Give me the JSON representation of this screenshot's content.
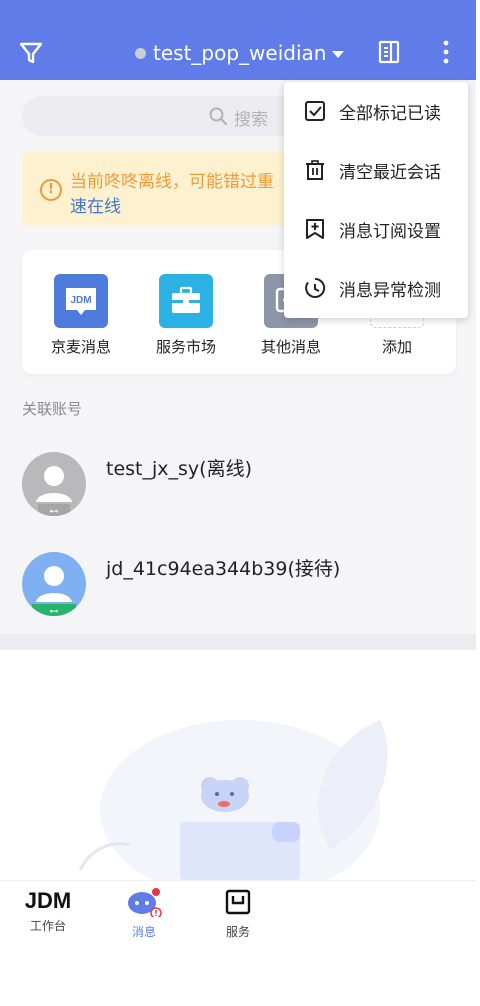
{
  "header": {
    "account_name": "test_pop_weidian",
    "status_color": "#c9cdd6",
    "bg_color": "#5f7ce9"
  },
  "search": {
    "placeholder": "搜索"
  },
  "banner": {
    "text_line1": "当前咚咚离线，可能错过重",
    "text_line2": "速在线"
  },
  "quick_entries": [
    {
      "label": "京麦消息",
      "icon": "jdm-message-icon",
      "color": "#4f7bdc",
      "badge": "JDM"
    },
    {
      "label": "服务市场",
      "icon": "briefcase-icon",
      "color": "#2bb1e4"
    },
    {
      "label": "其他消息",
      "icon": "other-message-icon",
      "color": "#8d96a8"
    },
    {
      "label": "添加",
      "icon": "add-icon"
    }
  ],
  "linked_accounts": {
    "section_label": "关联账号",
    "items": [
      {
        "name": "test_jx_sy(离线)",
        "avatar_color": "#b9b9bc"
      },
      {
        "name": "jd_41c94ea344b39(接待)",
        "avatar_color": "#7fb1f2",
        "badge_color": "#27b46a"
      }
    ]
  },
  "tabbar": {
    "tabs": [
      {
        "label": "工作台",
        "logo": "JDM"
      },
      {
        "label": "消息",
        "active": true
      },
      {
        "label": "服务"
      }
    ]
  },
  "menu": {
    "items": [
      {
        "label": "全部标记已读",
        "icon": "check-square-icon"
      },
      {
        "label": "清空最近会话",
        "icon": "trash-icon"
      },
      {
        "label": "消息订阅设置",
        "icon": "bookmark-add-icon"
      },
      {
        "label": "消息异常检测",
        "icon": "diagnose-icon"
      }
    ]
  }
}
